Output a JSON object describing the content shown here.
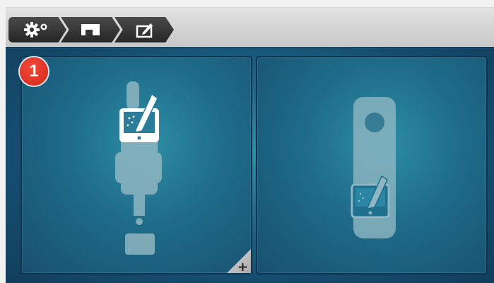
{
  "breadcrumb": {
    "items": [
      {
        "icon": "settings-gear-icon"
      },
      {
        "icon": "machine-icon"
      },
      {
        "icon": "edit-screen-icon"
      }
    ]
  },
  "colors": {
    "panel_center": "#2f8fa5",
    "panel_edge": "#123d5c",
    "badge": "#e0392a",
    "illustration": "#8fb6c2"
  },
  "options": [
    {
      "step": "1",
      "icon": "stitch-unit-with-screen-icon",
      "has_add": true,
      "add_symbol": "+"
    },
    {
      "icon": "device-with-screen-icon"
    }
  ]
}
